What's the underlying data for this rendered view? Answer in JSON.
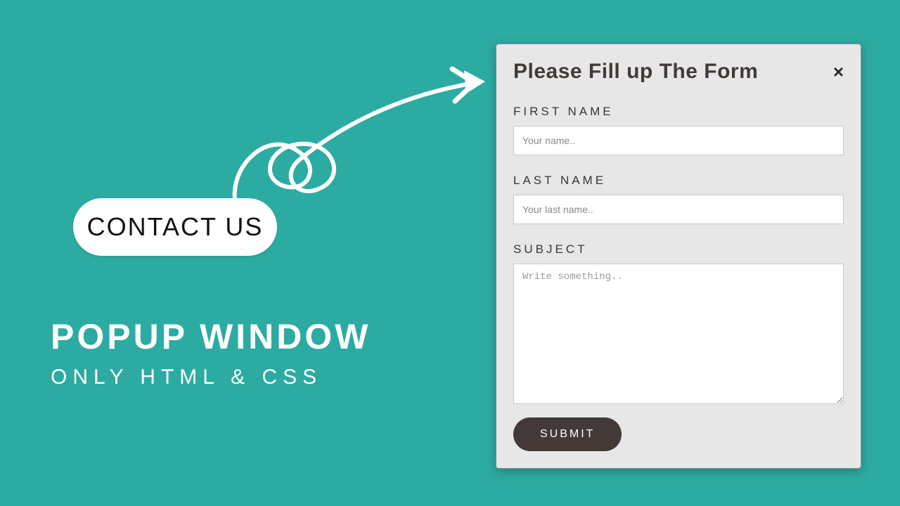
{
  "pill": {
    "label": "CONTACT US"
  },
  "headline": {
    "title": "POPUP WINDOW",
    "subtitle": "ONLY HTML & CSS"
  },
  "popup": {
    "title": "Please Fill up The Form",
    "close": "×",
    "fields": {
      "first_name": {
        "label": "FIRST NAME",
        "placeholder": "Your name.."
      },
      "last_name": {
        "label": "LAST NAME",
        "placeholder": "Your last name.."
      },
      "subject": {
        "label": "SUBJECT",
        "placeholder": "Write something.."
      }
    },
    "submit_label": "SUBMIT"
  },
  "colors": {
    "bg": "#2caba2",
    "dark": "#433A38",
    "panel": "#e7e7e7"
  }
}
